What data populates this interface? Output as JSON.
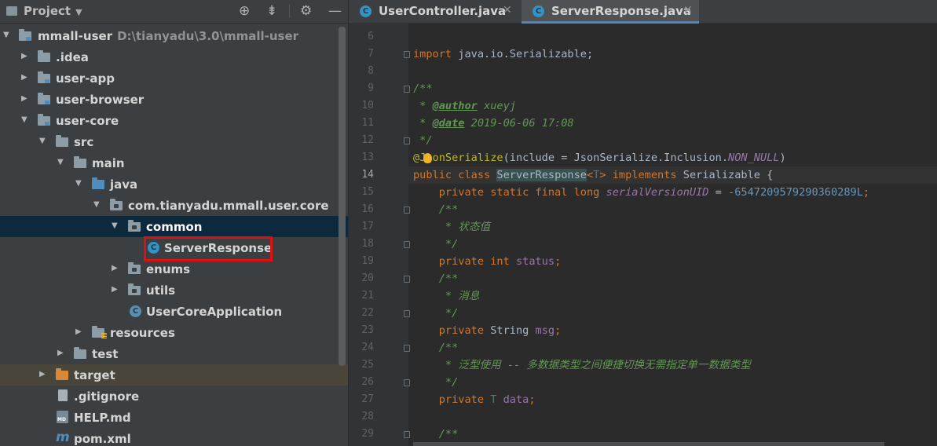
{
  "project_panel": {
    "title": "Project",
    "header_icons": [
      "crosshair-icon",
      "collapse-all-icon",
      "gear-icon",
      "minimize-icon"
    ],
    "tree": [
      {
        "label": "mmall-user",
        "path": "D:\\tianyadu\\3.0\\mmall-user",
        "kind": "module",
        "expanded": true
      },
      {
        "label": ".idea",
        "kind": "folder",
        "expanded": false
      },
      {
        "label": "user-app",
        "kind": "module",
        "expanded": false
      },
      {
        "label": "user-browser",
        "kind": "module",
        "expanded": false
      },
      {
        "label": "user-core",
        "kind": "module",
        "expanded": true
      },
      {
        "label": "src",
        "kind": "folder",
        "expanded": true
      },
      {
        "label": "main",
        "kind": "folder",
        "expanded": true
      },
      {
        "label": "java",
        "kind": "source-folder",
        "expanded": true
      },
      {
        "label": "com.tianyadu.mmall.user.core",
        "kind": "package",
        "expanded": true
      },
      {
        "label": "common",
        "kind": "package",
        "expanded": true,
        "selected": true
      },
      {
        "label": "ServerResponse",
        "kind": "class",
        "highlighted": true
      },
      {
        "label": "enums",
        "kind": "package",
        "expanded": false
      },
      {
        "label": "utils",
        "kind": "package",
        "expanded": false
      },
      {
        "label": "UserCoreApplication",
        "kind": "spring-class"
      },
      {
        "label": "resources",
        "kind": "resources-folder",
        "expanded": false
      },
      {
        "label": "test",
        "kind": "folder",
        "expanded": false
      },
      {
        "label": "target",
        "kind": "excluded-folder",
        "expanded": false
      },
      {
        "label": ".gitignore",
        "kind": "file"
      },
      {
        "label": "HELP.md",
        "kind": "markdown-file"
      },
      {
        "label": "pom.xml",
        "kind": "maven-file"
      }
    ]
  },
  "editor": {
    "tabs": [
      {
        "label": "UserController.java",
        "active": false,
        "close": "✕"
      },
      {
        "label": "ServerResponse.java",
        "active": true,
        "close": "✕"
      }
    ],
    "current_line": 14,
    "lines": [
      {
        "n": 6,
        "text": ""
      },
      {
        "n": 7,
        "text": "import java.io.Serializable;"
      },
      {
        "n": 8,
        "text": ""
      },
      {
        "n": 9,
        "text": "/**"
      },
      {
        "n": 10,
        "text": " * @author xueyj"
      },
      {
        "n": 11,
        "text": " * @date 2019-06-06 17:08"
      },
      {
        "n": 12,
        "text": " */"
      },
      {
        "n": 13,
        "text": "@JsonSerialize(include = JsonSerialize.Inclusion.NON_NULL)"
      },
      {
        "n": 14,
        "text": "public class ServerResponse<T> implements Serializable {"
      },
      {
        "n": 15,
        "text": "    private static final long serialVersionUID = -6547209579290360289L;"
      },
      {
        "n": 16,
        "text": "    /**"
      },
      {
        "n": 17,
        "text": "     * 状态值"
      },
      {
        "n": 18,
        "text": "     */"
      },
      {
        "n": 19,
        "text": "    private int status;"
      },
      {
        "n": 20,
        "text": "    /**"
      },
      {
        "n": 21,
        "text": "     * 消息"
      },
      {
        "n": 22,
        "text": "     */"
      },
      {
        "n": 23,
        "text": "    private String msg;"
      },
      {
        "n": 24,
        "text": "    /**"
      },
      {
        "n": 25,
        "text": "     * 泛型使用 -- 多数据类型之间便捷切换无需指定单一数据类型"
      },
      {
        "n": 26,
        "text": "     */"
      },
      {
        "n": 27,
        "text": "    private T data;"
      },
      {
        "n": 28,
        "text": ""
      },
      {
        "n": 29,
        "text": "    /**"
      }
    ],
    "tokens": {
      "import_kw": "import",
      "import_rest": " java.io.Serializable;",
      "doc_open": "/**",
      "doc_star": " * ",
      "author_tag": "@author",
      "author_val": " xueyj",
      "date_tag": "@date",
      "date_val": " 2019-06-06 17:08",
      "doc_close": " */",
      "ann_name": "@JsonSerialize",
      "ann_args_a": "(include = JsonSerialize.Inclusion.",
      "ann_const": "NON_NULL",
      "ann_close": ")",
      "l14_kw": "public class ",
      "l14_cls": "ServerResponse",
      "l14_lt": "<",
      "l14_T": "T",
      "l14_gt": "> ",
      "l14_impl": "implements",
      "l14_rest": " Serializable {",
      "l15_kw": "    private static final long ",
      "l15_field": "serialVersionUID",
      "l15_eq": " = ",
      "l15_num": "-6547209579290360289L",
      "l15_semi": ";",
      "l16": "    /**",
      "l17": "     * 状态值",
      "l18": "     */",
      "l19_kw": "    private int ",
      "l19_field": "status",
      "l19_semi": ";",
      "l20": "    /**",
      "l21": "     * 消息",
      "l22": "     */",
      "l23_kw": "    private ",
      "l23_type": "String ",
      "l23_field": "msg",
      "l23_semi": ";",
      "l24": "    /**",
      "l25": "     * 泛型使用 -- 多数据类型之间便捷切换无需指定单一数据类型",
      "l26": "     */",
      "l27_kw": "    private ",
      "l27_T": "T ",
      "l27_field": "data",
      "l27_semi": ";",
      "l29": "    /**"
    }
  },
  "colors": {
    "panel_bg": "#3c3f41",
    "editor_bg": "#2b2b2b",
    "selection": "#0d293e",
    "highlight_box": "#e01010",
    "keyword": "#cc7832",
    "doc_comment": "#629755"
  }
}
